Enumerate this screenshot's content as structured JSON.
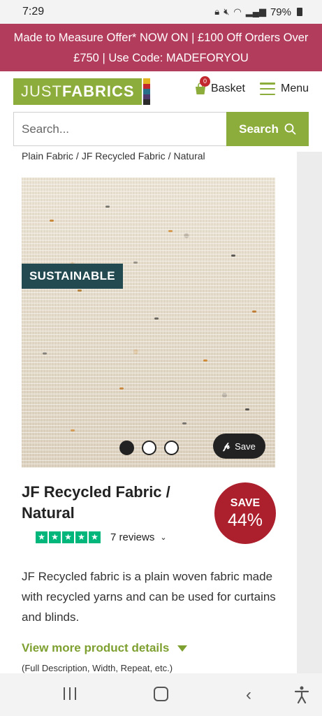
{
  "status": {
    "time": "7:29",
    "battery": "79%"
  },
  "promo": {
    "text": "Made to Measure Offer* NOW ON | £100 Off Orders Over £750 | Use Code: MADEFORYOU"
  },
  "header": {
    "logo_just": "JUST",
    "logo_fabrics": "FABRICS",
    "basket_label": "Basket",
    "basket_count": "0",
    "menu_label": "Menu",
    "brand_color": "#8cad3c"
  },
  "search": {
    "placeholder": "Search...",
    "button_label": "Search"
  },
  "breadcrumb": [
    "Plain Fabric",
    "JF Recycled Fabric",
    "Natural"
  ],
  "product": {
    "tag": "SUSTAINABLE",
    "pin_label": "Save",
    "title": "JF Recycled Fabric / Natural",
    "save_label": "SAVE",
    "save_pct": "44%",
    "reviews_label": "7 reviews",
    "rating_stars": 5,
    "description": "JF Recycled fabric is a plain woven fabric made with recycled yarns and can be used for curtains and blinds.",
    "more_details": "View more product details",
    "more_details_sub": "(Full Description, Width, Repeat, etc.)",
    "image_count": 3,
    "active_image": 1
  },
  "colors": {
    "promo_bg": "#b23c5c",
    "tag_bg": "#224a50",
    "save_bg": "#ac1f2d",
    "trustpilot": "#00b67a"
  }
}
